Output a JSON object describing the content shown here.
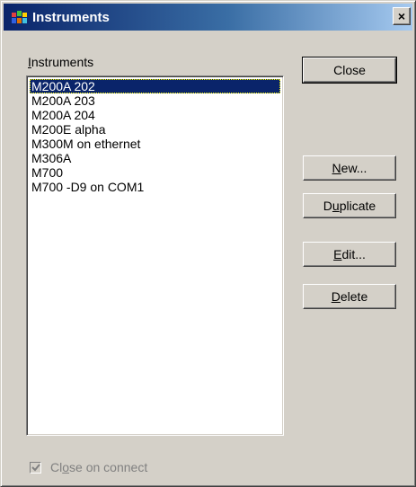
{
  "window": {
    "title": "Instruments",
    "close_glyph": "×",
    "icon": "instrument-app-icon"
  },
  "list": {
    "label_prefix": "",
    "label_mnemonic": "I",
    "label_rest": "nstruments",
    "items": [
      "M200A 202",
      "M200A 203",
      "M200A 204",
      "M200E alpha",
      "M300M on ethernet",
      "M306A",
      "M700",
      "M700 -D9 on COM1"
    ],
    "selected_index": 0
  },
  "buttons": {
    "close": {
      "pre": "Close",
      "mn": "",
      "post": ""
    },
    "new": {
      "pre": "",
      "mn": "N",
      "post": "ew..."
    },
    "duplicate": {
      "pre": "D",
      "mn": "u",
      "post": "plicate"
    },
    "edit": {
      "pre": "",
      "mn": "E",
      "post": "dit..."
    },
    "delete": {
      "pre": "",
      "mn": "D",
      "post": "elete"
    }
  },
  "checkbox": {
    "pre": "Cl",
    "mn": "o",
    "post": "se on connect",
    "checked": true,
    "disabled": true
  },
  "colors": {
    "selection": "#0a246a",
    "title_gradient_start": "#0a246a",
    "title_gradient_end": "#a6caf0",
    "face": "#d4d0c8"
  }
}
